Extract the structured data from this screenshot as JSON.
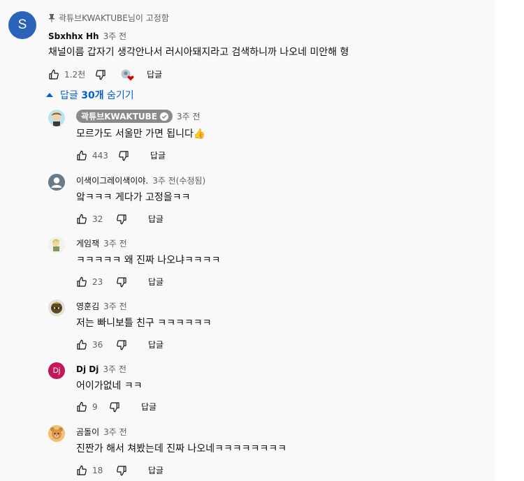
{
  "pinned": {
    "pin_label": "곽튜브KWAKTUBE님이 고정함",
    "avatar_letter": "S",
    "avatar_color": "#2a63b7",
    "author": "Sbxhhx Hh",
    "time": "3주 전",
    "text": "채널이름 갑자기 생각안나서 러시아돼지라고 검색하니까 나오네 미안해 형",
    "likes": "1.2천",
    "reply_label": "답글"
  },
  "replies_toggle": {
    "label_prefix": "답글 ",
    "count_label": "30개",
    "label_suffix": " 숨기기"
  },
  "replies": [
    {
      "author": "곽튜브KWAKTUBE",
      "owner": true,
      "time": "3주 전",
      "text": "모르가도 서울만 가면 됩니다👍",
      "likes": "443",
      "reply_label": "답글",
      "avatar": "owner"
    },
    {
      "author": "이색이그레이색이야.",
      "owner": false,
      "time": "3주 전(수정됨)",
      "text": "앜ㅋㅋㅋ 게다가 고정을ㅋㅋ",
      "likes": "32",
      "reply_label": "답글",
      "avatar": "default"
    },
    {
      "author": "게임잭",
      "owner": false,
      "time": "3주 전",
      "text": "ㅋㅋㅋㅋㅋ 왜 진짜 나오냐ㅋㅋㅋㅋ",
      "likes": "23",
      "reply_label": "답글",
      "avatar": "char1"
    },
    {
      "author": "영훈김",
      "owner": false,
      "time": "3주 전",
      "text": "저는 빠니보틀 친구 ㅋㅋㅋㅋㅋㅋ",
      "likes": "36",
      "reply_label": "답글",
      "avatar": "char2"
    },
    {
      "author": "Dj Dj",
      "owner": false,
      "time": "3주 전",
      "text": "어이가없네 ㅋㅋ",
      "likes": "9",
      "reply_label": "답글",
      "avatar": "dj",
      "avatar_letter": "Dj",
      "avatar_color": "#c2185b"
    },
    {
      "author": "곰돌이",
      "owner": false,
      "time": "3주 전",
      "text": "진짠가 해서 쳐봤는데 진짜 나오네ㅋㅋㅋㅋㅋㅋㅋㅋ",
      "likes": "18",
      "reply_label": "답글",
      "avatar": "bear"
    }
  ]
}
